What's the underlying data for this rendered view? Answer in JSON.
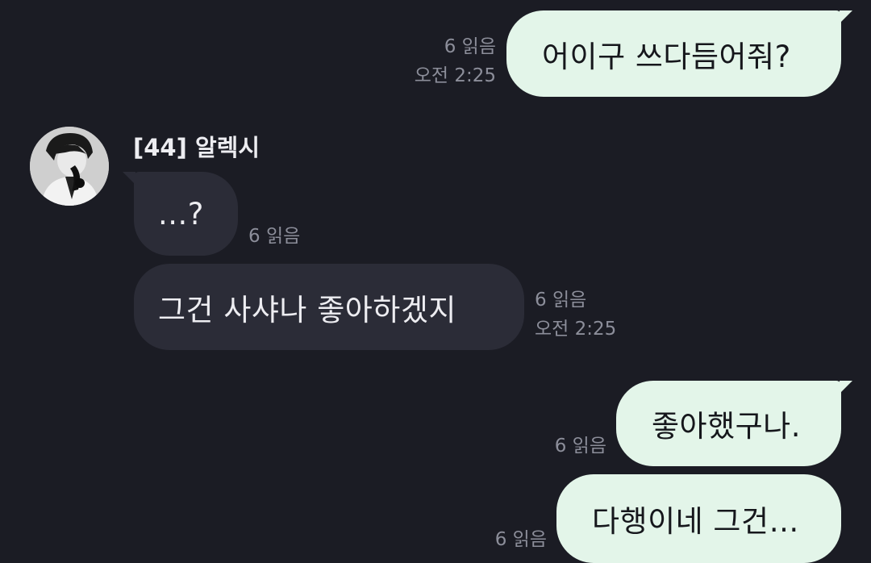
{
  "messages": [
    {
      "direction": "out",
      "text": "어이구 쓰다듬어줘?",
      "read": "6 읽음",
      "time": "오전 2:25"
    },
    {
      "direction": "in",
      "sender": "[44] 알렉시",
      "text": "...?",
      "read": "6 읽음"
    },
    {
      "direction": "in",
      "text": "그건 사샤나 좋아하겠지",
      "read": "6 읽음",
      "time": "오전 2:25"
    },
    {
      "direction": "out",
      "text": "좋아했구나.",
      "read": "6 읽음"
    },
    {
      "direction": "out",
      "text": "다행이네 그건…",
      "read": "6 읽음"
    }
  ],
  "avatar_icon": "user-avatar-icon",
  "colors": {
    "background": "#1b1c24",
    "outgoing_bubble": "#e3f5e9",
    "incoming_bubble": "#2b2c37",
    "meta_text": "#8c8e9a"
  }
}
